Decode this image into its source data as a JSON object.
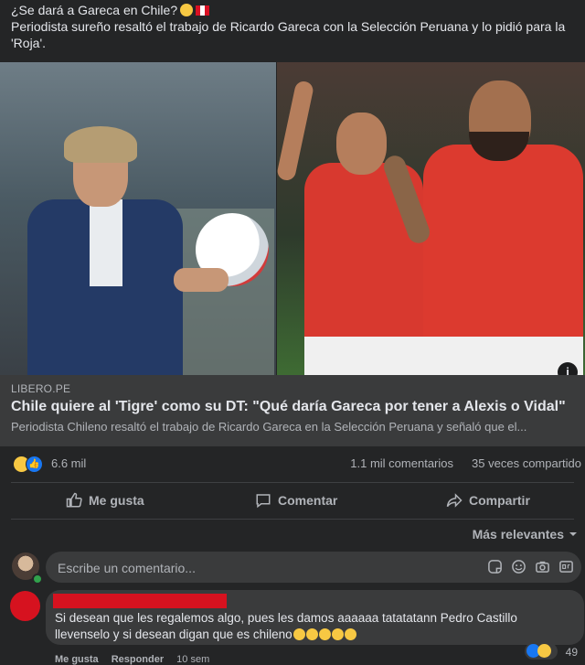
{
  "post": {
    "line1": "¿Se dará a Gareca en Chile?",
    "line2": "Periodista sureño resaltó el trabajo de Ricardo Gareca con la Selección Peruana y lo pidió para la 'Roja'."
  },
  "link": {
    "domain": "LIBERO.PE",
    "title": "Chile quiere al 'Tigre' como su DT: \"Qué daría Gareca por tener a Alexis o Vidal\"",
    "description": "Periodista Chileno resaltó el trabajo de Ricardo Gareca en la Selección Peruana y señaló que el..."
  },
  "stats": {
    "reactions": "6.6 mil",
    "comments": "1.1 mil comentarios",
    "shares": "35 veces compartido"
  },
  "actions": {
    "like": "Me gusta",
    "comment": "Comentar",
    "share": "Compartir"
  },
  "sort": {
    "label": "Más relevantes"
  },
  "composer": {
    "placeholder": "Escribe un comentario..."
  },
  "comment": {
    "text_line1": "Si desean que les regalemos algo, pues les damos aaaaaa tatatatann Pedro Castillo",
    "text_line2": "llevenselo y si desean digan que es chileno",
    "like_label": "Me gusta",
    "reply_label": "Responder",
    "time": "10 sem",
    "reaction_count": "49"
  },
  "colors": {
    "background": "#242526",
    "surface": "#3a3b3c",
    "text": "#e4e6eb",
    "secondary_text": "#b0b3b8",
    "like_blue": "#1877f2",
    "redaction_red": "#d6121f"
  }
}
